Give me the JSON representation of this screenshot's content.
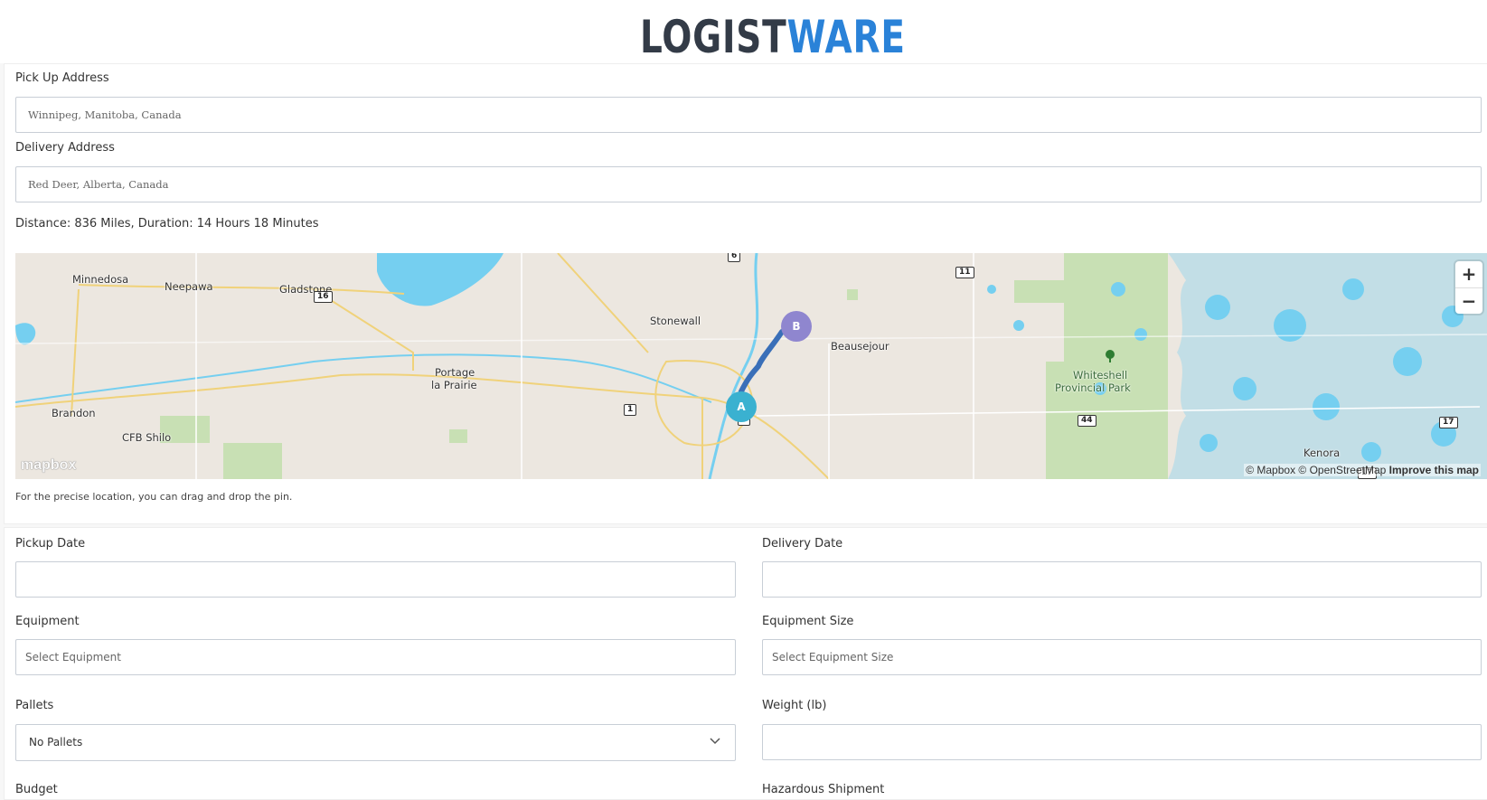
{
  "brand": {
    "logo_part1": "LOGIST",
    "logo_part2": "WARE"
  },
  "pickup": {
    "label": "Pick Up Address",
    "value": "Winnipeg, Manitoba, Canada"
  },
  "delivery": {
    "label": "Delivery Address",
    "value": "Red Deer, Alberta, Canada"
  },
  "route": {
    "summary": "Distance: 836 Miles, Duration: 14 Hours 18 Minutes"
  },
  "map": {
    "zoom_in": "+",
    "zoom_out": "−",
    "attribution": "© Mapbox © OpenStreetMap",
    "improve_link": "Improve this map",
    "logo": "mapbox",
    "marker_a": "A",
    "marker_b": "B",
    "places": [
      "Minnedosa",
      "Neepawa",
      "Gladstone",
      "Stonewall",
      "Beausejour",
      "Portage",
      "la Prairie",
      "Brandon",
      "CFB Shilo",
      "Whiteshell",
      "Provincial Park",
      "Kenora"
    ],
    "shields": [
      "16",
      "11",
      "1",
      "1",
      "44",
      "17",
      "6",
      "17"
    ],
    "colors": {
      "land": "#ece7e0",
      "water": "#75cff0",
      "park": "#c8e0b4",
      "route": "#3a6fb8",
      "marker_a": "#3ab1d0",
      "marker_b": "#8f86cf"
    },
    "icons": [
      "plus-icon",
      "minus-icon",
      "tree-icon",
      "mapbox-logo"
    ]
  },
  "hint": "For the precise location, you can drag and drop the pin.",
  "form": {
    "pickup_date": {
      "label": "Pickup Date",
      "value": ""
    },
    "delivery_date": {
      "label": "Delivery Date",
      "value": ""
    },
    "equipment": {
      "label": "Equipment",
      "placeholder": "Select Equipment"
    },
    "equipment_size": {
      "label": "Equipment Size",
      "placeholder": "Select Equipment Size"
    },
    "pallets": {
      "label": "Pallets",
      "value": "No Pallets"
    },
    "weight": {
      "label": "Weight (lb)",
      "value": ""
    },
    "budget": {
      "label": "Budget"
    },
    "hazardous": {
      "label": "Hazardous Shipment"
    }
  }
}
